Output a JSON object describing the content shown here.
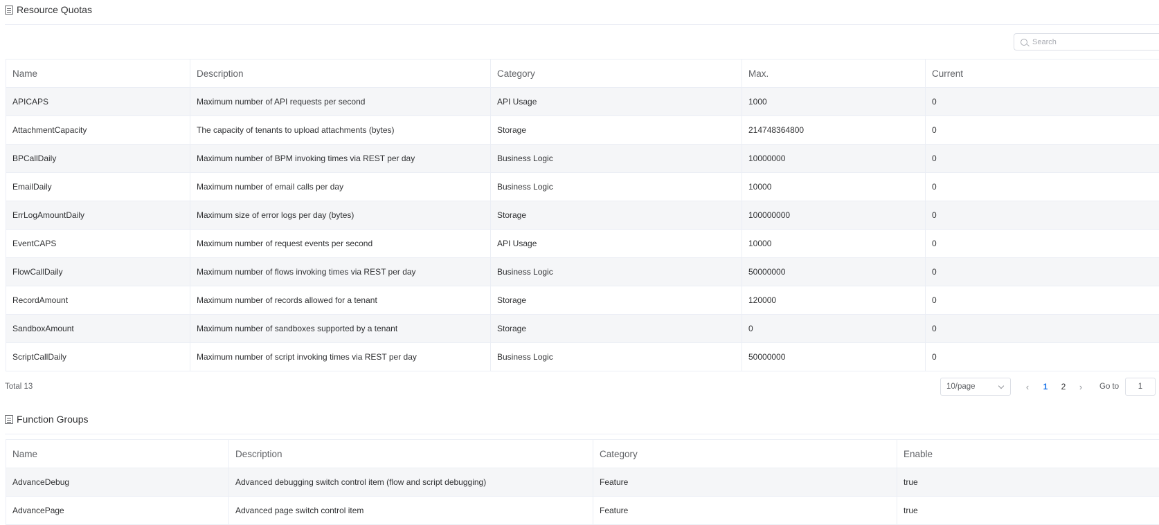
{
  "resource_quotas": {
    "title": "Resource Quotas",
    "search_placeholder": "Search",
    "columns": [
      "Name",
      "Description",
      "Category",
      "Max.",
      "Current"
    ],
    "rows": [
      [
        "APICAPS",
        "Maximum number of API requests per second",
        "API Usage",
        "1000",
        "0"
      ],
      [
        "AttachmentCapacity",
        "The capacity of tenants to upload attachments (bytes)",
        "Storage",
        "214748364800",
        "0"
      ],
      [
        "BPCallDaily",
        "Maximum number of BPM invoking times via REST per day",
        "Business Logic",
        "10000000",
        "0"
      ],
      [
        "EmailDaily",
        "Maximum number of email calls per day",
        "Business Logic",
        "10000",
        "0"
      ],
      [
        "ErrLogAmountDaily",
        "Maximum size of error logs per day (bytes)",
        "Storage",
        "100000000",
        "0"
      ],
      [
        "EventCAPS",
        "Maximum number of request events per second",
        "API Usage",
        "10000",
        "0"
      ],
      [
        "FlowCallDaily",
        "Maximum number of flows invoking times via REST per day",
        "Business Logic",
        "50000000",
        "0"
      ],
      [
        "RecordAmount",
        "Maximum number of records allowed for a tenant",
        "Storage",
        "120000",
        "0"
      ],
      [
        "SandboxAmount",
        "Maximum number of sandboxes supported by a tenant",
        "Storage",
        "0",
        "0"
      ],
      [
        "ScriptCallDaily",
        "Maximum number of script invoking times via REST per day",
        "Business Logic",
        "50000000",
        "0"
      ]
    ],
    "pagination": {
      "total_label": "Total 13",
      "page_size": "10/page",
      "pages": [
        "1",
        "2"
      ],
      "current_page": "1",
      "goto_label": "Go to",
      "goto_value": "1",
      "prev_glyph": "‹",
      "next_glyph": "›"
    }
  },
  "function_groups": {
    "title": "Function Groups",
    "columns": [
      "Name",
      "Description",
      "Category",
      "Enable"
    ],
    "rows": [
      [
        "AdvanceDebug",
        "Advanced debugging switch control item (flow and script debugging)",
        "Feature",
        "true"
      ],
      [
        "AdvancePage",
        "Advanced page switch control item",
        "Feature",
        "true"
      ]
    ]
  },
  "icons": {
    "section_icon": "list-document-icon",
    "search_icon": "search-icon"
  },
  "colors": {
    "active_page": "#1a73e8",
    "stripe": "#f5f6f8",
    "border": "#ebeef5"
  }
}
